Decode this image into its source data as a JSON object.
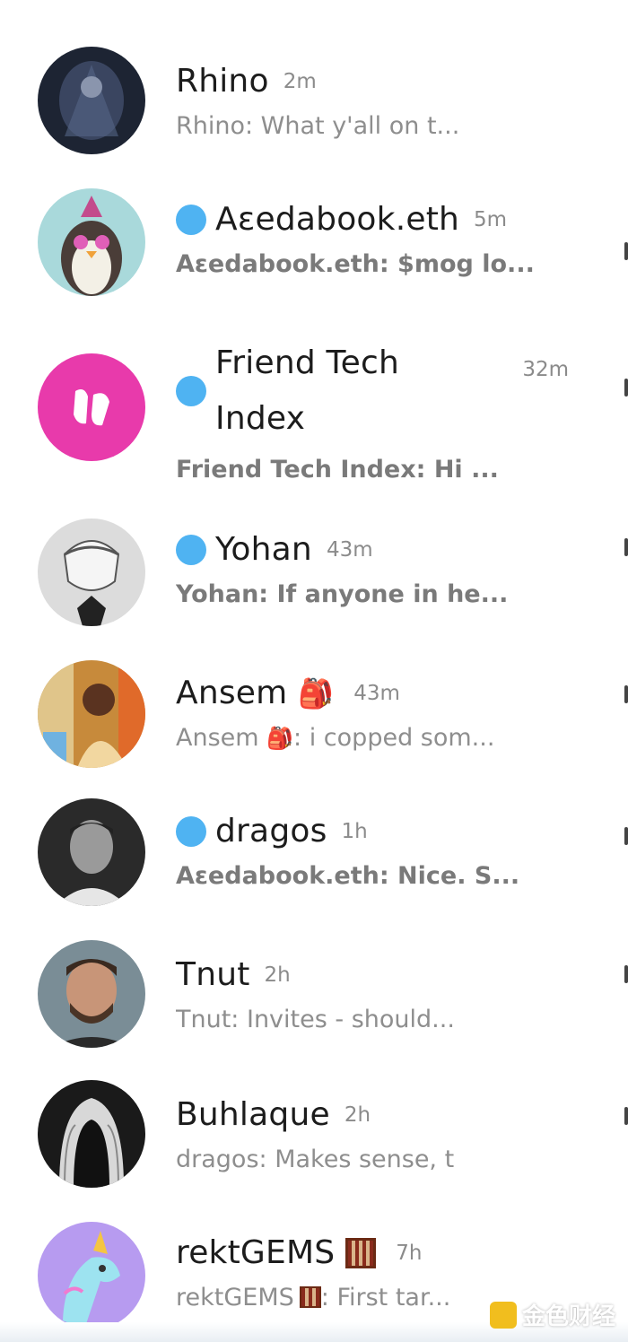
{
  "chats": [
    {
      "name": "Rhino",
      "time": "2m",
      "preview": "Rhino: What y'all on t...",
      "unread": false,
      "avatar_icon": "dark-warrior-avatar",
      "avatar_bg": "#1d2433"
    },
    {
      "name": "Aεedabook.eth",
      "time": "5m",
      "preview": "Aεedabook.eth: $mog lo...",
      "unread": true,
      "avatar_icon": "penguin-avatar",
      "avatar_bg": "#a9d9db"
    },
    {
      "name_line1": "Friend Tech",
      "name_line2": "Index",
      "time": "32m",
      "preview": "Friend Tech Index: Hi ...",
      "unread": true,
      "avatar_icon": "friend-tech-logo-avatar",
      "avatar_bg": "#e83aab"
    },
    {
      "name": "Yohan",
      "time": "43m",
      "preview": "Yohan: If anyone in he...",
      "unread": true,
      "avatar_icon": "anime-sketch-avatar",
      "avatar_bg": "#dcdcdc"
    },
    {
      "name": "Ansem",
      "name_emoji": "🎒",
      "time": "43m",
      "preview_prefix": "Ansem",
      "preview_emoji": "🎒",
      "preview_rest": ": i copped som...",
      "unread": false,
      "avatar_icon": "person-photo-avatar",
      "avatar_bg": "#c78a3b"
    },
    {
      "name": "dragos",
      "time": "1h",
      "preview": "Aεedabook.eth: Nice. S...",
      "unread": true,
      "avatar_icon": "man-bw-photo-avatar",
      "avatar_bg": "#2a2a2a"
    },
    {
      "name": "Tnut",
      "time": "2h",
      "preview": "Tnut: Invites - should...",
      "unread": false,
      "avatar_icon": "bearded-man-avatar",
      "avatar_bg": "#7a8d96"
    },
    {
      "name": "Buhlaque",
      "time": "2h",
      "preview": "dragos: Makes sense, t",
      "unread": false,
      "avatar_icon": "hooded-figure-avatar",
      "avatar_bg": "#1a1a1a"
    },
    {
      "name": "rektGEMS",
      "name_emoji": "abacus-emoji",
      "time": "7h",
      "preview_prefix": "rektGEMS",
      "preview_emoji": "abacus-emoji",
      "preview_rest": ": First tar...",
      "unread": false,
      "avatar_icon": "unicorn-avatar",
      "avatar_bg": "#b79bf0"
    }
  ],
  "watermark": {
    "text": "金色财经",
    "icon": "golden-finance-logo"
  },
  "colors": {
    "unread_dot": "#4fb3f2",
    "name": "#1c1c1c",
    "time": "#8b8b8b",
    "preview": "#8e8e8e"
  }
}
